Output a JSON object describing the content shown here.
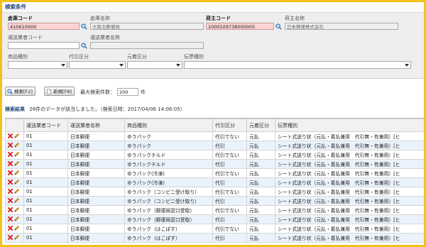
{
  "panel_title": "検索条件",
  "fields": {
    "warehouse_code_label": "倉庫コード",
    "warehouse_code_value": "410610000",
    "warehouse_name_label": "倉庫名称",
    "warehouse_name_value": "大阪北郵便局",
    "shipper_code_label": "荷主コード",
    "shipper_code_value": "1000109738000005",
    "shipper_name_label": "荷主名称",
    "shipper_name_value": "日本郵便株式会社",
    "carrier_code_label": "運送業者コード",
    "carrier_code_value": "",
    "carrier_name_label": "運送業者名称",
    "carrier_name_value": "",
    "product_type_label": "商品種別",
    "cod_label": "代引区分",
    "payment_label": "元着区分",
    "slip_type_label": "伝票種別"
  },
  "toolbar": {
    "search_label": "検索[F2]",
    "new_label": "新規[F8]",
    "max_label": "最大検索件数：",
    "max_value": "200",
    "max_unit": "件"
  },
  "result": {
    "label": "検索結果",
    "message": "26件のデータが該当しました。（検索日時：2017/04/06 14:06:05）"
  },
  "table": {
    "headers": [
      "",
      "運送業者コード",
      "運送業者名称",
      "商品種別",
      "代引区分",
      "元着区分",
      "伝票種別"
    ],
    "rows": [
      {
        "code": "01",
        "carrier": "日本郵便",
        "product": "ゆうパック",
        "cod": "代引でない",
        "pay": "元払",
        "slip": "シート式送り状（元払・着払兼用　代引無・有兼用）[ヒ"
      },
      {
        "code": "01",
        "carrier": "日本郵便",
        "product": "ゆうパック",
        "cod": "代引",
        "pay": "元払",
        "slip": "シート式送り状（元払・着払兼用　代引無・有兼用）[ヒ"
      },
      {
        "code": "01",
        "carrier": "日本郵便",
        "product": "ゆうパックチルド",
        "cod": "代引でない",
        "pay": "元払",
        "slip": "シート式送り状（元払・着払兼用　代引無・有兼用）[ヒ"
      },
      {
        "code": "01",
        "carrier": "日本郵便",
        "product": "ゆうパックチルド",
        "cod": "代引",
        "pay": "元払",
        "slip": "シート式送り状（元払・着払兼用　代引無・有兼用）[ヒ"
      },
      {
        "code": "01",
        "carrier": "日本郵便",
        "product": "ゆうパック(冷凍)",
        "cod": "代引でない",
        "pay": "元払",
        "slip": "シート式送り状（元払・着払兼用　代引無・有兼用）[ヒ"
      },
      {
        "code": "01",
        "carrier": "日本郵便",
        "product": "ゆうパック(冷凍)",
        "cod": "代引",
        "pay": "元払",
        "slip": "シート式送り状（元払・着払兼用　代引無・有兼用）[ヒ"
      },
      {
        "code": "01",
        "carrier": "日本郵便",
        "product": "ゆうパック（コンビニ受け取り）",
        "cod": "代引でない",
        "pay": "元払",
        "slip": "シート式送り状（元払・着払兼用　代引無・有兼用）[ヒ"
      },
      {
        "code": "01",
        "carrier": "日本郵便",
        "product": "ゆうパック（コンビニ受け取り）",
        "cod": "代引",
        "pay": "元払",
        "slip": "シート式送り状（元払・着払兼用　代引無・有兼用）[ヒ"
      },
      {
        "code": "01",
        "carrier": "日本郵便",
        "product": "ゆうパック（郵便局窓口受取）",
        "cod": "代引でない",
        "pay": "元払",
        "slip": "シート式送り状（元払・着払兼用　代引無・有兼用）[ヒ"
      },
      {
        "code": "01",
        "carrier": "日本郵便",
        "product": "ゆうパック（郵便局窓口受取）",
        "cod": "代引",
        "pay": "元払",
        "slip": "シート式送り状（元払・着払兼用　代引無・有兼用）[ヒ"
      },
      {
        "code": "01",
        "carrier": "日本郵便",
        "product": "ゆうパック（はこぽす）",
        "cod": "代引でない",
        "pay": "元払",
        "slip": "シート式送り状（元払・着払兼用　代引無・有兼用）[ヒ"
      },
      {
        "code": "01",
        "carrier": "日本郵便",
        "product": "ゆうパック（はこぽす）",
        "cod": "代引",
        "pay": "元払",
        "slip": "シート式送り状（元払・着払兼用　代引無・有兼用）[ヒ"
      }
    ]
  },
  "colors": {
    "frame": "#f2c21b",
    "required_bg": "#fbd4d4",
    "row_alt": "#eaf3fb",
    "title": "#2b4a80"
  },
  "icons": {
    "delete": "delete-x-icon",
    "edit": "pencil-icon",
    "lookup": "magnifier-icon"
  }
}
